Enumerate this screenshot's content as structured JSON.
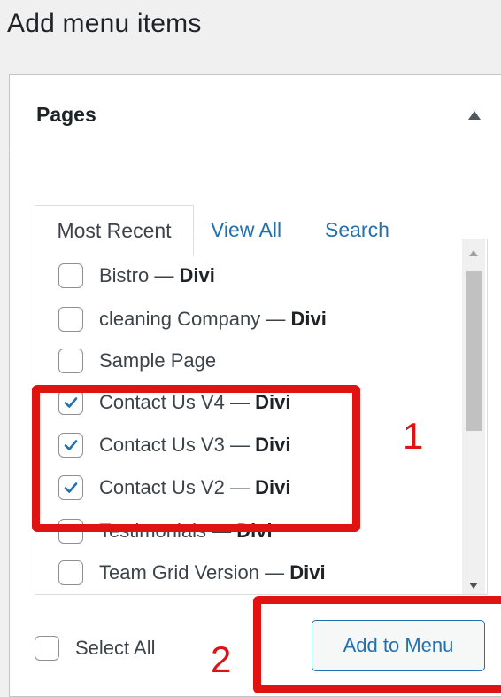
{
  "page_title": "Add menu items",
  "panel": {
    "title": "Pages",
    "toggle_icon": "triangle-up-icon"
  },
  "tabs": [
    {
      "label": "Most Recent",
      "active": true
    },
    {
      "label": "View All",
      "active": false
    },
    {
      "label": "Search",
      "active": false
    }
  ],
  "pages": [
    {
      "name": "Bistro",
      "separator": " — ",
      "theme": "Divi",
      "checked": false
    },
    {
      "name": "cleaning Company",
      "separator": " — ",
      "theme": "Divi",
      "checked": false
    },
    {
      "name": "Sample Page",
      "separator": "",
      "theme": "",
      "checked": false
    },
    {
      "name": "Contact Us V4",
      "separator": " — ",
      "theme": "Divi",
      "checked": true
    },
    {
      "name": "Contact Us V3",
      "separator": " — ",
      "theme": "Divi",
      "checked": true
    },
    {
      "name": "Contact Us V2",
      "separator": " — ",
      "theme": "Divi",
      "checked": true
    },
    {
      "name": "Testimonials",
      "separator": " — ",
      "theme": "Divi",
      "checked": false
    },
    {
      "name": "Team Grid Version",
      "separator": " — ",
      "theme": "Divi",
      "checked": false
    }
  ],
  "select_all": {
    "label": "Select All",
    "checked": false
  },
  "add_button": {
    "label": "Add to Menu"
  },
  "annotations": [
    {
      "label": "1",
      "color": "#e01313"
    },
    {
      "label": "2",
      "color": "#e01313"
    }
  ],
  "colors": {
    "link": "#2271b1",
    "checkmark": "#2271b1",
    "annotation": "#e01313"
  }
}
